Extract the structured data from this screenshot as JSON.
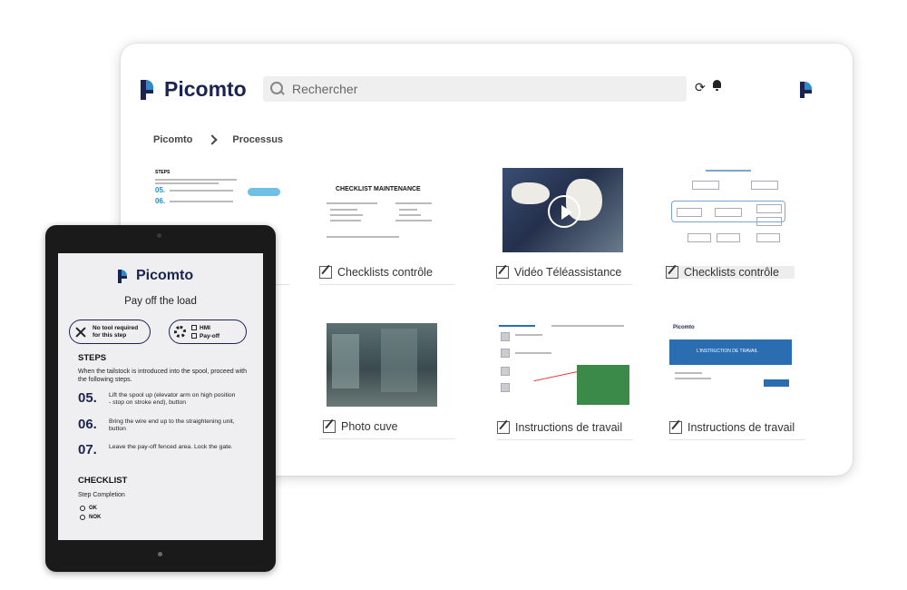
{
  "desktop": {
    "brand": "Picomto",
    "search_placeholder": "Rechercher",
    "icons": [
      "search-icon",
      "refresh-icon",
      "bell-icon",
      "picomto-logo-icon",
      "chevron-right-icon",
      "edit-document-icon",
      "play-icon"
    ],
    "breadcrumb": [
      "Picomto",
      "Processus"
    ],
    "cards": [
      {
        "label": "",
        "thumb_text": [
          "STEPS",
          "05.",
          "06."
        ]
      },
      {
        "label": "Checklists contrôle",
        "thumb_text": [
          "CHECKLIST MAINTENANCE"
        ]
      },
      {
        "label": "Vidéo Téléassistance"
      },
      {
        "label": "Checklists contrôle"
      },
      {
        "label": "Photo cuve"
      },
      {
        "label": "Instructions de travail"
      },
      {
        "label": "Instructions de travail",
        "thumb_text": [
          "Picomto",
          "L'INSTRUCTION DE TRAVAIL"
        ]
      }
    ]
  },
  "tablet": {
    "brand": "Picomto",
    "title": "Pay off the load",
    "tool_pill": {
      "line1": "No tool required",
      "line2": "for this step"
    },
    "equipment": [
      "HMI",
      "Pay-off"
    ],
    "steps_heading": "STEPS",
    "steps_intro": "When the tailstock is introduced into the spool, proceed with the following steps.",
    "steps": [
      {
        "num": "05.",
        "text": "Lift the spool up (elevator arm on high position - stop on stroke end), button"
      },
      {
        "num": "06.",
        "text": "Bring the wire end up to the straightening unit, button"
      },
      {
        "num": "07.",
        "text": "Leave the pay-off fenced area. Lock the gate."
      }
    ],
    "checklist_heading": "CHECKLIST",
    "checklist_sub": "Step Completion",
    "options": [
      "OK",
      "NOK"
    ]
  },
  "colors": {
    "brand_navy": "#1b2350",
    "brand_blue": "#2e89c9"
  }
}
